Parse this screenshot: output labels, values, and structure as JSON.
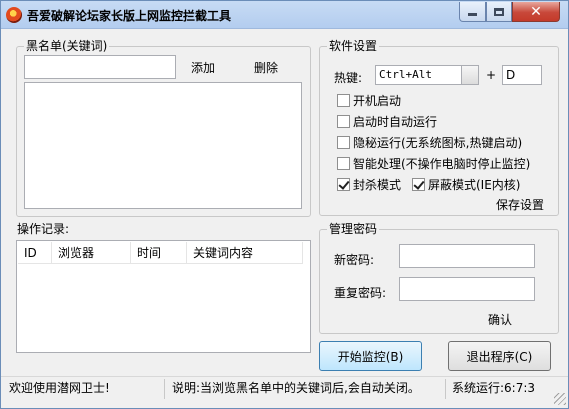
{
  "window": {
    "title": "吾爱破解论坛家长版上网监控拦截工具",
    "controls": {
      "close_glyph": "✕"
    }
  },
  "blacklist": {
    "legend": "黑名单(关键词)",
    "input_value": "",
    "add_label": "添加",
    "delete_label": "删除",
    "items": []
  },
  "settings": {
    "legend": "软件设置",
    "hotkey_label": "热键:",
    "hotkey_modifier": "Ctrl+Alt",
    "plus": "+",
    "hotkey_key": "D",
    "options": [
      {
        "label": "开机启动",
        "checked": false
      },
      {
        "label": "启动时自动运行",
        "checked": false
      },
      {
        "label": "隐秘运行(无系统图标,热键启动)",
        "checked": false
      },
      {
        "label": "智能处理(不操作电脑时停止监控)",
        "checked": false
      },
      {
        "label": "封杀模式",
        "checked": true
      },
      {
        "label": "屏蔽模式(IE内核)",
        "checked": true
      }
    ],
    "save_label": "保存设置"
  },
  "log": {
    "legend": "操作记录:",
    "columns": [
      "ID",
      "浏览器",
      "时间",
      "关键词内容"
    ],
    "rows": []
  },
  "password": {
    "legend": "管理密码",
    "new_label": "新密码:",
    "repeat_label": "重复密码:",
    "new_value": "",
    "repeat_value": "",
    "confirm_label": "确认"
  },
  "actions": {
    "start_label": "开始监控(B)",
    "exit_label": "退出程序(C)"
  },
  "status": {
    "welcome": "欢迎使用潜网卫士!",
    "hint": "说明:当浏览黑名单中的关键词后,会自动关闭。",
    "runtime": "系统运行:6:7:3"
  }
}
